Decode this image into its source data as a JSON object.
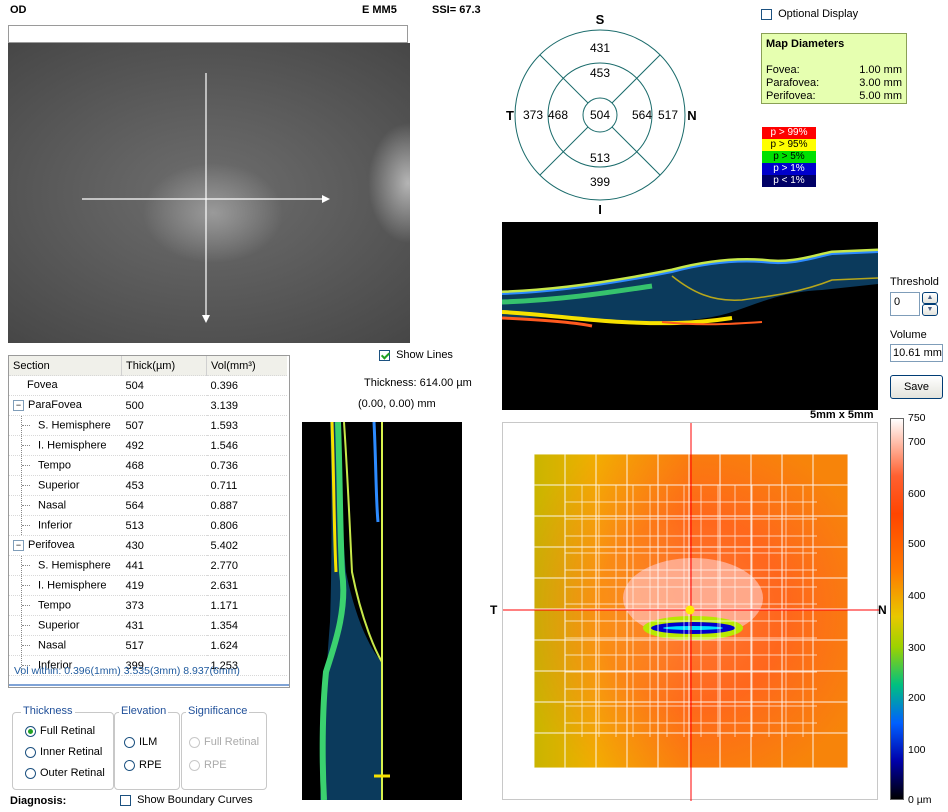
{
  "header": {
    "eye": "OD",
    "scan": "E MM5",
    "ssi": "SSI= 67.3"
  },
  "sector_map": {
    "labels": {
      "top": "S",
      "bottom": "I",
      "left": "T",
      "right": "N"
    },
    "values": {
      "center": "504",
      "outer_top": "431",
      "inner_top": "453",
      "inner_bottom": "513",
      "outer_bottom": "399",
      "outer_left": "373",
      "inner_left": "468",
      "inner_right": "564",
      "outer_right": "517"
    }
  },
  "optional_display": {
    "label": "Optional Display",
    "checked": false
  },
  "map_diameters": {
    "title": "Map Diameters",
    "rows": [
      {
        "label": "Fovea:",
        "value": "1.00 mm"
      },
      {
        "label": "Parafovea:",
        "value": "3.00 mm"
      },
      {
        "label": "Perifovea:",
        "value": "5.00 mm"
      }
    ]
  },
  "significance_legend": [
    {
      "label": "p > 99%",
      "color": "#ff0000",
      "text_color": "#ffffff"
    },
    {
      "label": "p > 95%",
      "color": "#ffff00",
      "text_color": "#000000"
    },
    {
      "label": "p > 5%",
      "color": "#00e000",
      "text_color": "#000000"
    },
    {
      "label": "p > 1%",
      "color": "#0000cc",
      "text_color": "#ffffff"
    },
    {
      "label": "p < 1%",
      "color": "#000066",
      "text_color": "#ffffff"
    }
  ],
  "threshold": {
    "label": "Threshold",
    "value": "0"
  },
  "volume": {
    "label": "Volume",
    "value": "10.61 mm³"
  },
  "save_label": "Save",
  "show_lines": {
    "label": "Show Lines",
    "checked": true
  },
  "thickness_readout": "Thickness: 614.00 µm",
  "coord_readout": "(0.00, 0.00) mm",
  "map_size_label": "5mm x 5mm",
  "thickness_map": {
    "left": "T",
    "right": "N"
  },
  "colorbar": {
    "ticks": [
      "750",
      "700",
      "600",
      "500",
      "400",
      "300",
      "200",
      "100",
      "0 µm"
    ]
  },
  "table": {
    "headers": [
      "Section",
      "Thick(µm)",
      "Vol(mm³)"
    ],
    "rows": [
      {
        "name": "Fovea",
        "thick": "504",
        "vol": "0.396",
        "level": 0,
        "expander": ""
      },
      {
        "name": "ParaFovea",
        "thick": "500",
        "vol": "3.139",
        "level": 0,
        "expander": "−"
      },
      {
        "name": "S. Hemisphere",
        "thick": "507",
        "vol": "1.593",
        "level": 1,
        "expander": ""
      },
      {
        "name": "I. Hemisphere",
        "thick": "492",
        "vol": "1.546",
        "level": 1,
        "expander": ""
      },
      {
        "name": "Tempo",
        "thick": "468",
        "vol": "0.736",
        "level": 1,
        "expander": ""
      },
      {
        "name": "Superior",
        "thick": "453",
        "vol": "0.711",
        "level": 1,
        "expander": ""
      },
      {
        "name": "Nasal",
        "thick": "564",
        "vol": "0.887",
        "level": 1,
        "expander": ""
      },
      {
        "name": "Inferior",
        "thick": "513",
        "vol": "0.806",
        "level": 1,
        "expander": ""
      },
      {
        "name": "Perifovea",
        "thick": "430",
        "vol": "5.402",
        "level": 0,
        "expander": "−"
      },
      {
        "name": "S. Hemisphere",
        "thick": "441",
        "vol": "2.770",
        "level": 1,
        "expander": ""
      },
      {
        "name": "I. Hemisphere",
        "thick": "419",
        "vol": "2.631",
        "level": 1,
        "expander": ""
      },
      {
        "name": "Tempo",
        "thick": "373",
        "vol": "1.171",
        "level": 1,
        "expander": ""
      },
      {
        "name": "Superior",
        "thick": "431",
        "vol": "1.354",
        "level": 1,
        "expander": ""
      },
      {
        "name": "Nasal",
        "thick": "517",
        "vol": "1.624",
        "level": 1,
        "expander": ""
      },
      {
        "name": "Inferior",
        "thick": "399",
        "vol": "1.253",
        "level": 1,
        "expander": ""
      }
    ],
    "footer": "Vol within: 0.396(1mm) 3.535(3mm) 8.937(6mm)"
  },
  "thickness_group": {
    "title": "Thickness",
    "options": [
      {
        "label": "Full Retinal",
        "selected": true
      },
      {
        "label": "Inner Retinal",
        "selected": false
      },
      {
        "label": "Outer Retinal",
        "selected": false
      }
    ]
  },
  "elevation_group": {
    "title": "Elevation",
    "options": [
      {
        "label": "ILM",
        "selected": false
      },
      {
        "label": "RPE",
        "selected": false
      }
    ]
  },
  "significance_group": {
    "title": "Significance",
    "options": [
      {
        "label": "Full Retinal",
        "selected": false
      },
      {
        "label": "RPE",
        "selected": false
      }
    ]
  },
  "diagnosis_label": "Diagnosis:",
  "show_boundary": {
    "label": "Show Boundary Curves",
    "checked": false
  }
}
